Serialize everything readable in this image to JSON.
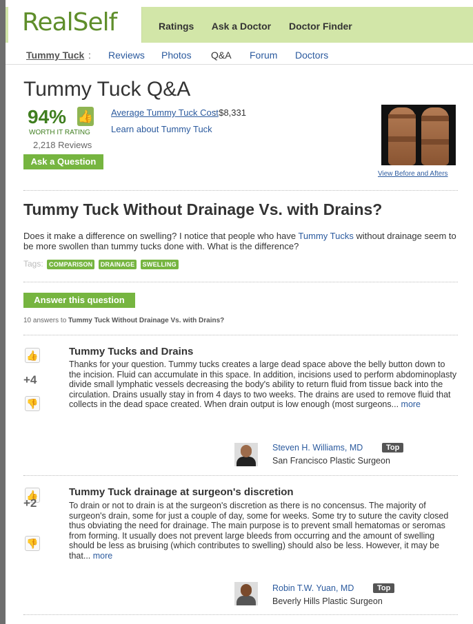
{
  "header": {
    "logo": "RealSelf",
    "nav": [
      "Ratings",
      "Ask a Doctor",
      "Doctor Finder"
    ]
  },
  "subnav": {
    "crumb": "Tummy Tuck",
    "colon": ":",
    "items": [
      "Reviews",
      "Photos",
      "Q&A",
      "Forum",
      "Doctors"
    ]
  },
  "summary": {
    "title": "Tummy Tuck Q&A",
    "worth_percent": "94%",
    "worth_label": "WORTH IT RATING",
    "reviews": "2,218 Reviews",
    "ask_button": "Ask a Question",
    "cost_link": "Average Tummy Tuck Cost",
    "cost_value": ": $8,331",
    "learn_link": "Learn about Tummy Tuck",
    "before_after_link": "View Before and Afters"
  },
  "question": {
    "title": "Tummy Tuck Without Drainage Vs. with Drains?",
    "text_before": "Does it make a difference on swelling? I notice that people who have ",
    "text_link": "Tummy Tucks",
    "text_after": " without drainage seem to be more swollen than tummy tucks done with. What is the difference?",
    "tags_label": "Tags:",
    "tags": [
      "COMPARISON",
      "DRAINAGE",
      "SWELLING"
    ],
    "answer_button": "Answer this question",
    "count_prefix": "10 answers to ",
    "count_title": "Tummy Tuck Without Drainage Vs. with Drains?"
  },
  "answers": [
    {
      "score": "+4",
      "title": "Tummy Tucks and Drains",
      "body": "Thanks for your question. Tummy tucks creates a large dead space above the belly button down to the incision. Fluid can accumulate in this space. In addition, incisions used to perform abdominoplasty divide small lymphatic vessels decreasing the body's ability to return fluid from tissue back into the circulation. Drains usually stay in from 4 days to two weeks. The drains are used to remove fluid that collects in the dead space created. When drain output is low enough (most surgeons... ",
      "more": "more",
      "doctor": "Steven H. Williams, MD",
      "badge": "Top",
      "location": "San Francisco Plastic Surgeon"
    },
    {
      "score": "+2",
      "title": "Tummy Tuck drainage at surgeon's discretion",
      "body": "To drain or not to drain is at the surgeon's discretion as there is no concensus. The majority of surgeon's drain, some for just a couple of day, some for weeks. Some try to suture the cavity closed thus obviating the need for drainage. The main purpose is to prevent small hematomas or seromas from forming. It usually does not prevent large bleeds from occurring and the amount of swelling should be less as bruising (which contributes to swelling) should also be less. However, it may be that... ",
      "more": "more",
      "doctor": "Robin T.W. Yuan, MD",
      "badge": "Top",
      "location": "Beverly Hills Plastic Surgeon"
    }
  ],
  "icons": {
    "thumb_up": "thumbs-up-icon",
    "thumb_down": "thumbs-down-icon"
  },
  "colors": {
    "brand_green": "#76b540",
    "header_green": "#d2e6a8",
    "link_blue": "#2b5a9e"
  }
}
